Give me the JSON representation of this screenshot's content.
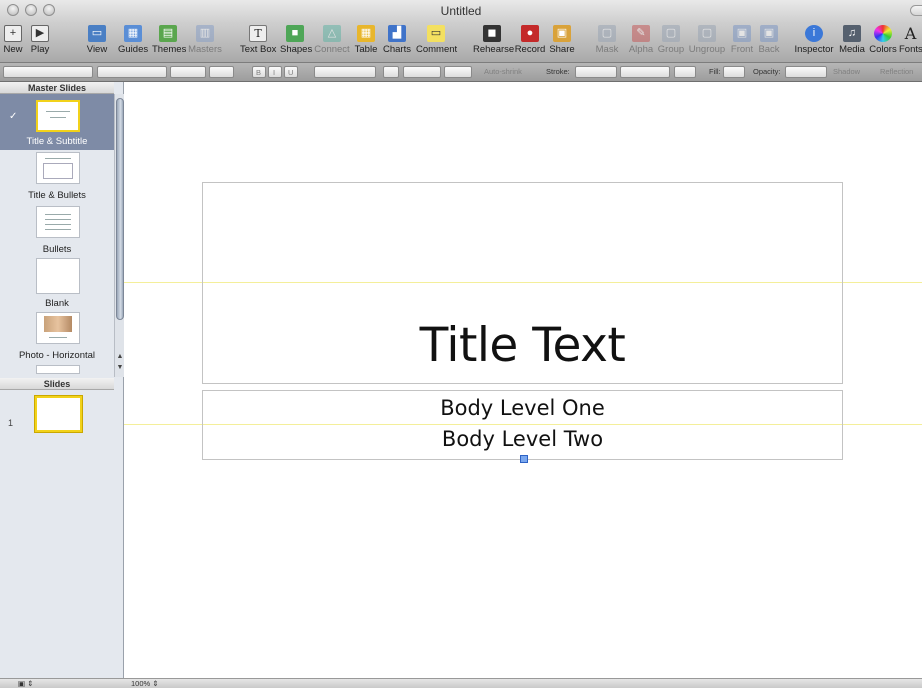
{
  "window": {
    "title": "Untitled"
  },
  "toolbar": {
    "items": [
      {
        "label": "New",
        "icon": "new-slide-icon"
      },
      {
        "label": "Play",
        "icon": "play-icon"
      },
      {
        "label": "View",
        "icon": "view-icon"
      },
      {
        "label": "Guides",
        "icon": "guides-icon"
      },
      {
        "label": "Themes",
        "icon": "themes-icon"
      },
      {
        "label": "Masters",
        "icon": "masters-icon"
      },
      {
        "label": "Text Box",
        "icon": "text-box-icon"
      },
      {
        "label": "Shapes",
        "icon": "shapes-icon"
      },
      {
        "label": "Connect",
        "icon": "connect-icon"
      },
      {
        "label": "Table",
        "icon": "table-icon"
      },
      {
        "label": "Charts",
        "icon": "charts-icon"
      },
      {
        "label": "Comment",
        "icon": "comment-icon"
      },
      {
        "label": "Rehearse",
        "icon": "rehearse-icon"
      },
      {
        "label": "Record",
        "icon": "record-icon"
      },
      {
        "label": "Share",
        "icon": "share-icon"
      },
      {
        "label": "Mask",
        "icon": "mask-icon"
      },
      {
        "label": "Alpha",
        "icon": "alpha-icon"
      },
      {
        "label": "Group",
        "icon": "group-icon"
      },
      {
        "label": "Ungroup",
        "icon": "ungroup-icon"
      },
      {
        "label": "Front",
        "icon": "front-icon"
      },
      {
        "label": "Back",
        "icon": "back-icon"
      },
      {
        "label": "Inspector",
        "icon": "inspector-icon"
      },
      {
        "label": "Media",
        "icon": "media-icon"
      },
      {
        "label": "Colors",
        "icon": "colors-icon"
      },
      {
        "label": "Fonts",
        "icon": "fonts-icon"
      }
    ]
  },
  "formatbar": {
    "text_b": "B",
    "text_i": "I",
    "text_u": "U",
    "auto_shrink": "Auto-shrink",
    "stroke_label": "Stroke:",
    "fill_label": "Fill:",
    "opacity_label": "Opacity:",
    "shadow_label": "Shadow",
    "reflection_label": "Reflection"
  },
  "navigator": {
    "master_header": "Master Slides",
    "masters": [
      {
        "label": "Title & Subtitle",
        "selected": true
      },
      {
        "label": "Title & Bullets",
        "selected": false
      },
      {
        "label": "Bullets",
        "selected": false
      },
      {
        "label": "Blank",
        "selected": false
      },
      {
        "label": "Photo - Horizontal",
        "selected": false
      }
    ],
    "slides_header": "Slides",
    "slide_number": "1"
  },
  "slide": {
    "title": "Title Text",
    "body_one": "Body Level One",
    "body_two": "Body Level Two"
  },
  "status": {
    "zoom": "100%"
  },
  "colors": {
    "selection_yellow": "#f2d21a",
    "selected_master_bg": "#7e8ba6",
    "guide": "#f4ef9a"
  }
}
